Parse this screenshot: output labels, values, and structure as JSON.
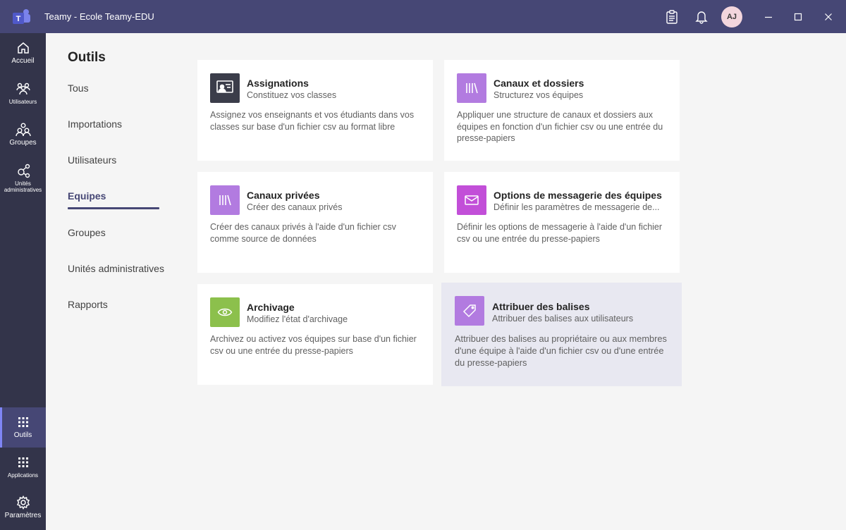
{
  "window": {
    "title": "Teamy - Ecole Teamy-EDU",
    "avatar_initials": "AJ"
  },
  "colors": {
    "titlebar": "#464775",
    "rail": "#33344a",
    "accent": "#464775",
    "icon_dark": "#3b3d4a",
    "icon_purple": "#b27be0",
    "icon_magenta": "#c24fd8",
    "icon_green": "#8cc04c",
    "highlight_card": "#e8e8f1"
  },
  "rail": {
    "items": [
      {
        "label": "Accueil",
        "icon": "home-icon"
      },
      {
        "label": "Utilisateurs",
        "icon": "users-icon"
      },
      {
        "label": "Groupes",
        "icon": "groups-icon"
      },
      {
        "label": "Unités administratives",
        "icon": "admin-units-icon"
      }
    ],
    "bottom": [
      {
        "label": "Outils",
        "icon": "grid-icon",
        "active": true
      },
      {
        "label": "Applications",
        "icon": "apps-grid-icon"
      },
      {
        "label": "Paramètres",
        "icon": "gear-icon"
      }
    ]
  },
  "page": {
    "title": "Outils"
  },
  "nav": {
    "items": [
      "Tous",
      "Importations",
      "Utilisateurs",
      "Equipes",
      "Groupes",
      "Unités administratives",
      "Rapports"
    ],
    "active": "Equipes"
  },
  "cards": [
    {
      "title": "Assignations",
      "subtitle": "Constituez vos classes",
      "description": "Assignez vos enseignants et vos étudiants dans vos classes sur base d'un fichier csv au format libre",
      "icon": "classroom-icon"
    },
    {
      "title": "Canaux et dossiers",
      "subtitle": "Structurez vos équipes",
      "description": "Appliquer une structure de canaux et dossiers aux équipes en fonction d'un fichier csv ou une entrée du presse-papiers",
      "icon": "library-icon"
    },
    {
      "title": "Canaux privées",
      "subtitle": "Créer des canaux privés",
      "description": "Créer des canaux privés à l'aide d'un fichier csv comme source de données",
      "icon": "library-icon"
    },
    {
      "title": "Options de messagerie des équipes",
      "subtitle": "Définir les paramètres de messagerie de...",
      "description": "Définir les options de messagerie à l'aide d'un fichier csv ou une entrée du presse-papiers",
      "icon": "mail-icon"
    },
    {
      "title": "Archivage",
      "subtitle": "Modifiez l'état d'archivage",
      "description": "Archivez ou activez vos équipes sur base d'un fichier csv ou une entrée du presse-papiers",
      "icon": "eye-icon"
    },
    {
      "title": "Attribuer des balises",
      "subtitle": "Attribuer des balises aux utilisateurs",
      "description": "Attribuer des balises au propriétaire ou aux membres d'une équipe à l'aide d'un fichier csv ou d'une entrée du presse-papiers",
      "icon": "tag-icon"
    }
  ]
}
